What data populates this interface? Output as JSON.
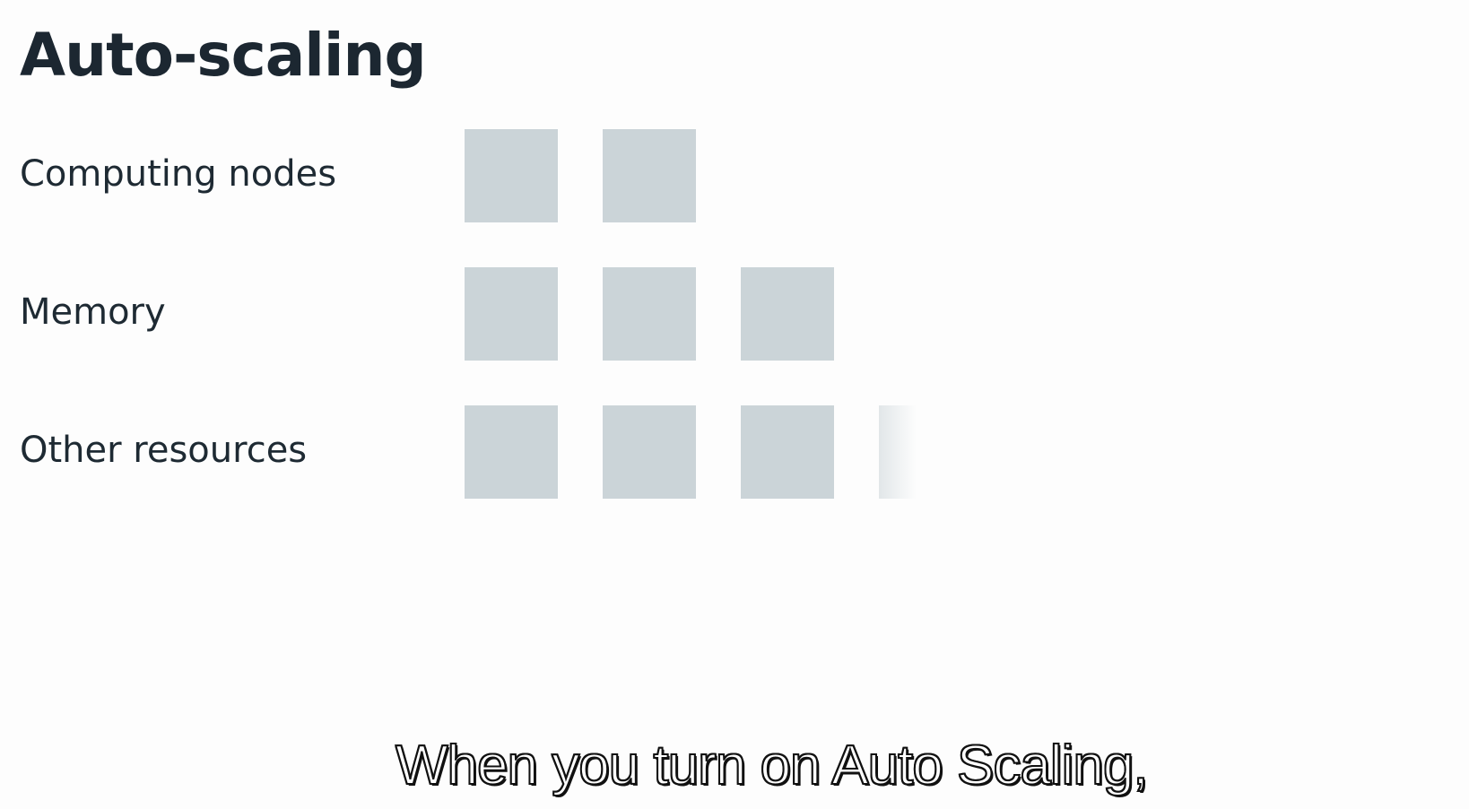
{
  "slide": {
    "title": "Auto-scaling",
    "rows": [
      {
        "label": "Computing nodes",
        "blocks": 2,
        "fading_blocks": 0
      },
      {
        "label": "Memory",
        "blocks": 3,
        "fading_blocks": 0
      },
      {
        "label": "Other resources",
        "blocks": 3,
        "fading_blocks": 1
      }
    ],
    "block_color": "#cbd4d8"
  },
  "caption": {
    "text": "When you turn on Auto Scaling,"
  }
}
